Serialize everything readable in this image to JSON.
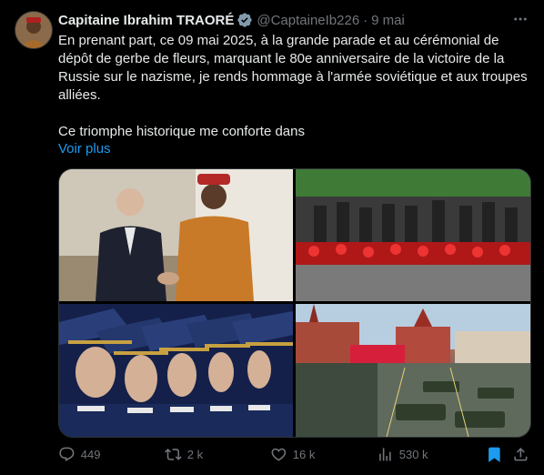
{
  "author": {
    "name": "Capitaine Ibrahim TRAORÉ",
    "handle": "@CaptaineIb226",
    "date": "9 mai",
    "separator": "·",
    "verified_color": "#71767b"
  },
  "tweet": {
    "paragraph1": "En prenant part, ce 09 mai 2025, à la grande parade et au cérémonial de dépôt de gerbe de fleurs, marquant le 80e anniversaire de la victoire de la Russie sur le nazisme, je rends hommage à l'armée soviétique et aux troupes alliées.",
    "paragraph2": "Ce triomphe historique me conforte dans",
    "more_link": "Voir plus"
  },
  "media": [
    {
      "name": "photo-handshake"
    },
    {
      "name": "photo-wreath-laying"
    },
    {
      "name": "photo-honor-guard"
    },
    {
      "name": "photo-red-square-parade"
    }
  ],
  "actions": {
    "replies": "449",
    "reposts": "2 k",
    "likes": "16 k",
    "views": "530 k"
  },
  "icons": {
    "reply": "reply-icon",
    "repost": "repost-icon",
    "like": "heart-icon",
    "views": "views-icon",
    "bookmark": "bookmark-icon",
    "share": "share-icon",
    "more": "more-icon",
    "verified": "verified-icon"
  },
  "colors": {
    "background": "#000000",
    "text": "#e7e9ea",
    "secondary": "#71767b",
    "link": "#1d9bf0",
    "bookmark": "#1d9bf0"
  }
}
